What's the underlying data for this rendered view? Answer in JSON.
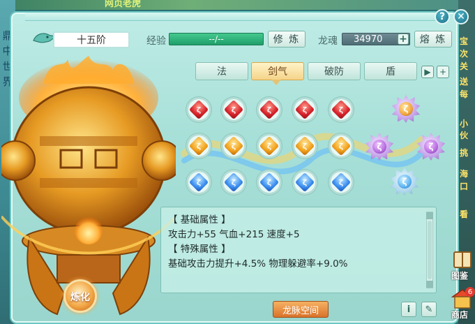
{
  "background": {
    "top_text": "网页老虎",
    "side_text": [
      "鼎",
      "中",
      "世",
      "界"
    ],
    "right_texts": [
      "宝",
      "次",
      "关",
      "送",
      "每",
      "小伙",
      "挑",
      "海",
      "口",
      "看"
    ]
  },
  "header": {
    "rank_label": "十五阶",
    "exp_label": "经验",
    "exp_value": "--/--",
    "cultivate_button": "修 炼",
    "soul_label": "龙魂",
    "soul_value": "34970",
    "smelt_button": "熔 炼",
    "help_icon": "?",
    "close_icon": "✕"
  },
  "tabs": [
    {
      "label": "法",
      "active": false
    },
    {
      "label": "剑气",
      "active": true
    },
    {
      "label": "破防",
      "active": false
    },
    {
      "label": "盾",
      "active": false
    }
  ],
  "gems": {
    "rows": [
      {
        "color": "red",
        "count": 5
      },
      {
        "color": "orange",
        "count": 5
      },
      {
        "color": "blue",
        "count": 5
      }
    ]
  },
  "attributes": {
    "basic_header": "【 基础属性 】",
    "basic_line": "攻击力+55  气血+215  速度+5",
    "special_header": "【 特殊属性 】",
    "special_line": "基础攻击力提升+4.5%  物理躲避率+9.0%"
  },
  "footer": {
    "refine_button": "炼化",
    "dragon_space_button": "龙脉空间",
    "info_icon": "i",
    "edit_icon": "✎"
  },
  "right_widgets": {
    "gallery_label": "图鉴",
    "shop_label": "商店",
    "shop_badge": "6"
  }
}
